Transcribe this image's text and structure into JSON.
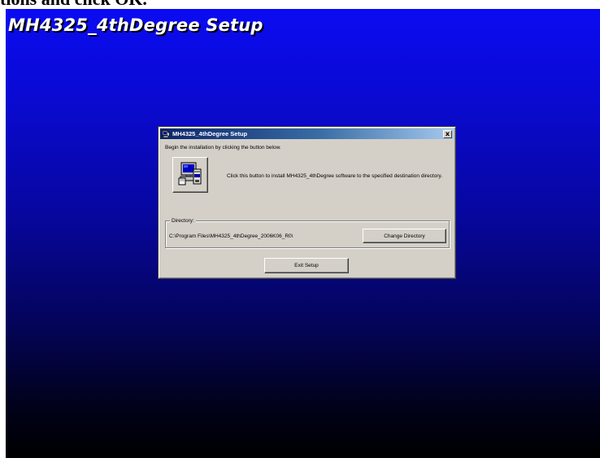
{
  "document": {
    "caption": "tions and click OK."
  },
  "desktop": {
    "banner_title": "MH4325_4thDegree Setup"
  },
  "dialog": {
    "title": "MH4325_4thDegree Setup",
    "close_glyph": "x",
    "instruction": "Begin the installation by clicking the button below.",
    "install_description": "Click this button to install MH4325_4thDegree software to the specified destination directory.",
    "directory_label": "Directory:",
    "directory_path": "C:\\Program Files\\MH4325_4thDegree_2006K06_R0\\",
    "change_directory_label": "Change Directory",
    "exit_setup_label": "Exit Setup"
  },
  "icons": {
    "title_icon": "setup-computer-icon",
    "install_icon": "computer-install-icon",
    "close_icon": "close-icon"
  },
  "colors": {
    "titlebar_start": "#0a246a",
    "titlebar_end": "#a6caf0",
    "dialog_face": "#d4d0c8",
    "desktop_top": "#0b0bf2",
    "desktop_bottom": "#000000"
  }
}
